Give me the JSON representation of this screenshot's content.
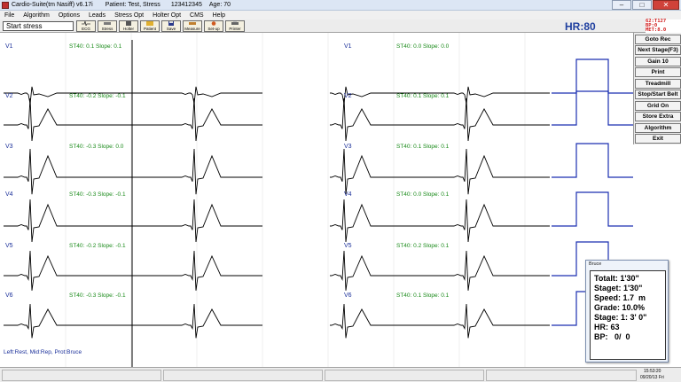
{
  "window": {
    "app_title": "Cardio-Suite(tm Nasiff) v6.17i",
    "patient": "Patient: Test, Stress",
    "patient_id": "123412345",
    "age": "Age: 70"
  },
  "menu": [
    "File",
    "Algorithm",
    "Options",
    "Leads",
    "Stress Opt",
    "Holter Opt",
    "CMS",
    "Help"
  ],
  "toolbar": {
    "status_text": "Start stress",
    "buttons": [
      {
        "label": "ECG",
        "icon": "ecg-icon"
      },
      {
        "label": "Stress",
        "icon": "stress-icon"
      },
      {
        "label": "Holter",
        "icon": "holter-icon"
      },
      {
        "label": "Patient",
        "icon": "patient-icon"
      },
      {
        "label": "Save",
        "icon": "save-icon"
      },
      {
        "label": "Measure",
        "icon": "measure-icon"
      },
      {
        "label": "Set-up",
        "icon": "setup-icon"
      },
      {
        "label": "Printer",
        "icon": "printer-icon"
      }
    ],
    "hr": "HR:80",
    "vitals": [
      "62:T127",
      "BP:0",
      "MET:8.0"
    ]
  },
  "ecg": {
    "left_panel": [
      {
        "lead": "V1",
        "st": "ST40: 0.1  Slope: 0.1"
      },
      {
        "lead": "V2",
        "st": "ST40: -0.2  Slope: -0.1"
      },
      {
        "lead": "V3",
        "st": "ST40: -0.3  Slope: 0.0"
      },
      {
        "lead": "V4",
        "st": "ST40: -0.3  Slope: -0.1"
      },
      {
        "lead": "V5",
        "st": "ST40: -0.2  Slope: -0.1"
      },
      {
        "lead": "V6",
        "st": "ST40: -0.3  Slope: -0.1"
      }
    ],
    "right_panel": [
      {
        "lead": "V1",
        "st": "ST40: 0.0  Slope: 0.0"
      },
      {
        "lead": "V2",
        "st": "ST40: 0.1  Slope: 0.1"
      },
      {
        "lead": "V3",
        "st": "ST40: 0.1  Slope: 0.1"
      },
      {
        "lead": "V4",
        "st": "ST40: 0.0  Slope: 0.1"
      },
      {
        "lead": "V5",
        "st": "ST40: 0.2  Slope: 0.1"
      },
      {
        "lead": "V6",
        "st": "ST40: 0.1  Slope: 0.1"
      }
    ],
    "protocol": "Left:Rest, Mid:Rep, Prot:Bruce",
    "trace_color": "#000000",
    "marker_color": "#1a2fb0"
  },
  "side_buttons": [
    "Goto Rec",
    "Next Stage(F3)",
    "Gain 10",
    "Print",
    "Treadmill",
    "Stop/Start Belt",
    "Grid On",
    "Store Extra",
    "Algorithm",
    "Exit"
  ],
  "bruce": {
    "title": "Bruce",
    "total": "Totalt: 1'30\"",
    "stage_time": "Staget: 1'30\"",
    "speed": "Speed: 1.7  m",
    "grade": "Grade: 10.0%",
    "stage": "Stage: 1: 3' 0\"",
    "hr": "HR: 63",
    "bp": "BP:   0/  0"
  },
  "statusbar": {
    "time": "15:53:20",
    "date": "09/20/13 Fri"
  }
}
